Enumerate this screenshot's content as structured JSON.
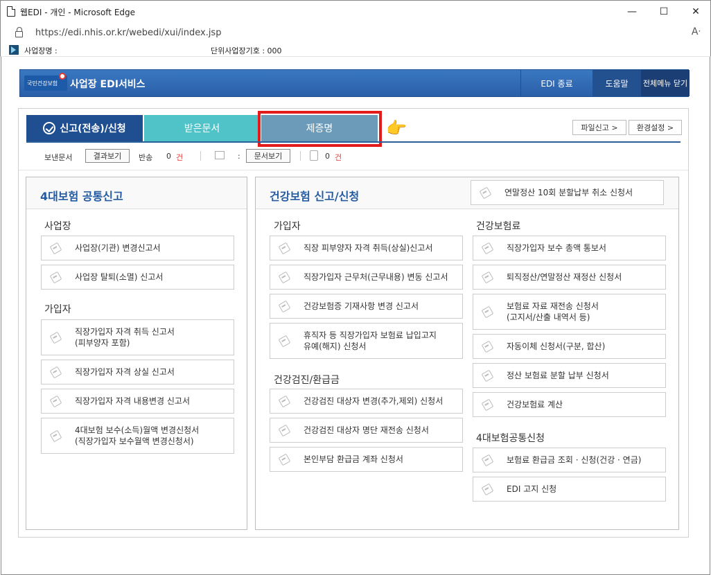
{
  "window": {
    "title": "웹EDI - 개인 - Microsoft Edge",
    "url": "https://edi.nhis.or.kr/webedi/xui/index.jsp",
    "minimize": "—",
    "maximize": "☐",
    "close": "✕",
    "read_aloud": "Aᐧ"
  },
  "infobar": {
    "company_label": "사업장명 :",
    "unit_label": "단위사업장기호 : 000"
  },
  "header": {
    "brand_text": "국민건강보험",
    "service_title": "사업장 EDI서비스",
    "end_button": "EDI 종료",
    "help_button": "도움말",
    "close_menu_button": "전체메뉴 닫기"
  },
  "tabs": {
    "send": "신고(전송)/신청",
    "received": "받은문서",
    "certificate": "제증명",
    "file_report": "파일신고 >",
    "settings": "환경설정 >"
  },
  "status": {
    "sent_docs_label": "보낸문서",
    "view_results_button": "결과보기",
    "returned_label": "반송",
    "returned_count": "0",
    "unit": "건",
    "colon": ":",
    "view_docs_button": "문서보기",
    "doc_count": "0",
    "unit2": "건"
  },
  "left_panel": {
    "title": "4대보험 공통신고",
    "sections": [
      {
        "title": "사업장",
        "items": [
          "사업장(기관) 변경신고서",
          "사업장 탈퇴(소멸) 신고서"
        ]
      },
      {
        "title": "가입자",
        "items": [
          "직장가입자 자격 취득 신고서\n(피부양자 포함)",
          "직장가입자 자격 상실 신고서",
          "직장가입자 자격 내용변경 신고서",
          "4대보험 보수(소득)월액 변경신청서\n(직장가입자 보수월액 변경신청서)"
        ]
      }
    ]
  },
  "right_panel": {
    "title": "건강보험 신고/신청",
    "top_item": "연말정산 10회 분할납부 취소 신청서",
    "col1": [
      {
        "title": "가입자",
        "items": [
          "직장 피부양자 자격 취득(상실)신고서",
          "직장가입자 근무처(근무내용) 변동 신고서",
          "건강보험증 기재사항 변경 신고서",
          "휴직자 등 직장가입자 보험료 납입고지\n유예(해지) 신청서"
        ]
      },
      {
        "title": "건강검진/환급금",
        "items": [
          "건강검진 대상자 변경(추가,제외) 신청서",
          "건강검진 대상자 명단 재전송 신청서",
          "본인부담 환급금 계좌 신청서"
        ]
      }
    ],
    "col2": [
      {
        "title": "건강보험료",
        "items": [
          "직장가입자 보수 총액 통보서",
          "퇴직정산/연말정산 재정산 신청서",
          "보험료 자료 재전송 신청서\n(고지서/산출 내역서 등)",
          "자동이체 신청서(구분, 합산)",
          "정산 보험료 분할 납부 신청서",
          "건강보험료 계산"
        ]
      },
      {
        "title": "4대보험공통신청",
        "items": [
          "보험료 환급금 조회 · 신청(건강 · 연금)",
          "EDI 고지 신청"
        ]
      }
    ]
  }
}
